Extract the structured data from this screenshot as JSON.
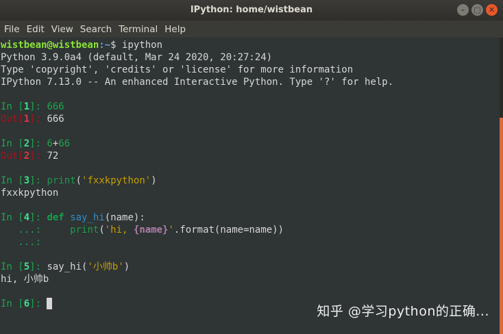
{
  "window": {
    "title": "IPython: home/wistbean",
    "controls": {
      "minimize": "–",
      "maximize": "□",
      "close": "✕"
    }
  },
  "menu": [
    "File",
    "Edit",
    "View",
    "Search",
    "Terminal",
    "Help"
  ],
  "shell": {
    "user_host": "wistbean@wistbean",
    "path": ":~",
    "prompt_symbol": "$ ",
    "command": "ipython"
  },
  "banner": [
    "Python 3.9.0a4 (default, Mar 24 2020, 20:27:24)",
    "Type 'copyright', 'credits' or 'license' for more information",
    "IPython 7.13.0 -- An enhanced Interactive Python. Type '?' for help."
  ],
  "cells": {
    "in1": {
      "n": "1",
      "code": "666"
    },
    "out1": {
      "n": "1",
      "text": "666"
    },
    "in2": {
      "a": "6",
      "op": "+",
      "b": "66",
      "n": "2"
    },
    "out2": {
      "n": "2",
      "text": "72"
    },
    "in3": {
      "n": "3",
      "fn": "print",
      "open": "(",
      "arg": "'fxxkpython'",
      "close": ")"
    },
    "stdout3": "fxxkpython",
    "in4": {
      "n": "4",
      "kw": "def",
      "fn": "say_hi",
      "sig": "(name):"
    },
    "in4_cont": {
      "prompt": "   ...: ",
      "indent": "    ",
      "fn": "print",
      "open": "(",
      "str_a": "'hi, ",
      "fmt": "{name}",
      "str_b": "'",
      "rest": ".format(name=name))"
    },
    "in4_end": {
      "prompt": "   ...: "
    },
    "in5": {
      "n": "5",
      "fn": "say_hi(",
      "arg": "'小帅b'",
      "close": ")"
    },
    "stdout5": "hi, 小帅b",
    "in6": {
      "n": "6"
    }
  },
  "prompt_parts": {
    "in": "In [",
    "out": "Out[",
    "close": "]: "
  },
  "watermark": "知乎 @学习python的正确...",
  "colors": {
    "accent": "#d86a3c",
    "in_prompt": "#1fa64b",
    "out_prompt": "#a3131a",
    "background": "#2f3435"
  }
}
